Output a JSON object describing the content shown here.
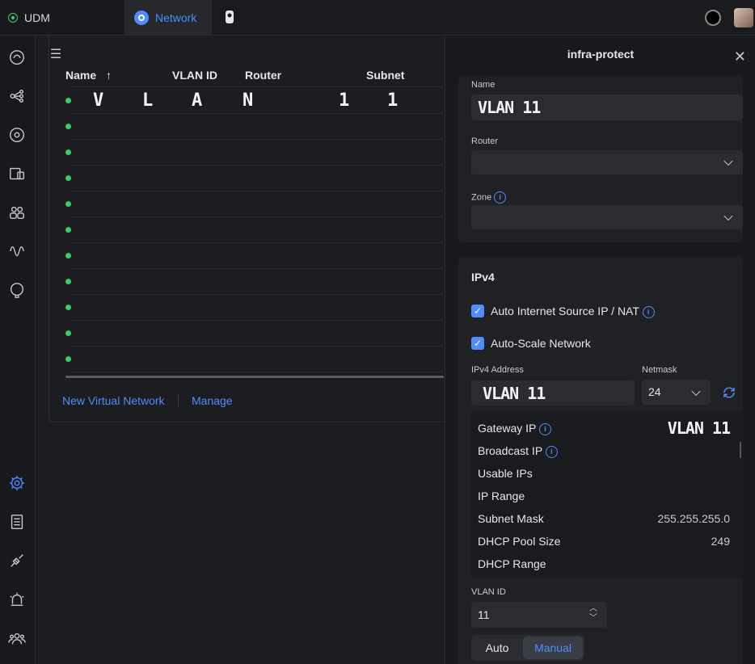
{
  "topbar": {
    "udm_label": "UDM",
    "network_label": "Network"
  },
  "table": {
    "headers": {
      "name": "Name",
      "sort_arrow": "↑",
      "vlan_id": "VLAN ID",
      "router": "Router",
      "subnet": "Subnet"
    },
    "first_row_chars": [
      "V",
      "L",
      "A",
      "N",
      "1",
      "1"
    ],
    "row_count": 11
  },
  "footer": {
    "new_virtual_network": "New Virtual Network",
    "manage": "Manage"
  },
  "panel": {
    "title": "infra-protect",
    "name_label": "Name",
    "name_value": "VLAN 11",
    "router_label": "Router",
    "zone_label": "Zone",
    "ipv4_title": "IPv4",
    "auto_source_nat": "Auto Internet Source IP / NAT",
    "auto_scale": "Auto-Scale Network",
    "ipv4_address_label": "IPv4 Address",
    "ipv4_address_value": "VLAN 11",
    "netmask_label": "Netmask",
    "netmask_value": "24",
    "info": {
      "gateway_ip": "Gateway IP",
      "gateway_value": "VLAN 11",
      "broadcast_ip": "Broadcast IP",
      "usable_ips": "Usable IPs",
      "ip_range": "IP Range",
      "subnet_mask": "Subnet Mask",
      "subnet_mask_value": "255.255.255.0",
      "dhcp_pool_size": "DHCP Pool Size",
      "dhcp_pool_size_value": "249",
      "dhcp_range": "DHCP Range"
    },
    "vlan_id_label": "VLAN ID",
    "vlan_id_value": "11",
    "mode_auto": "Auto",
    "mode_manual": "Manual"
  },
  "colors": {
    "accent": "#4f8cff",
    "status_ok": "#3ecf62",
    "background": "#1c1d20"
  }
}
